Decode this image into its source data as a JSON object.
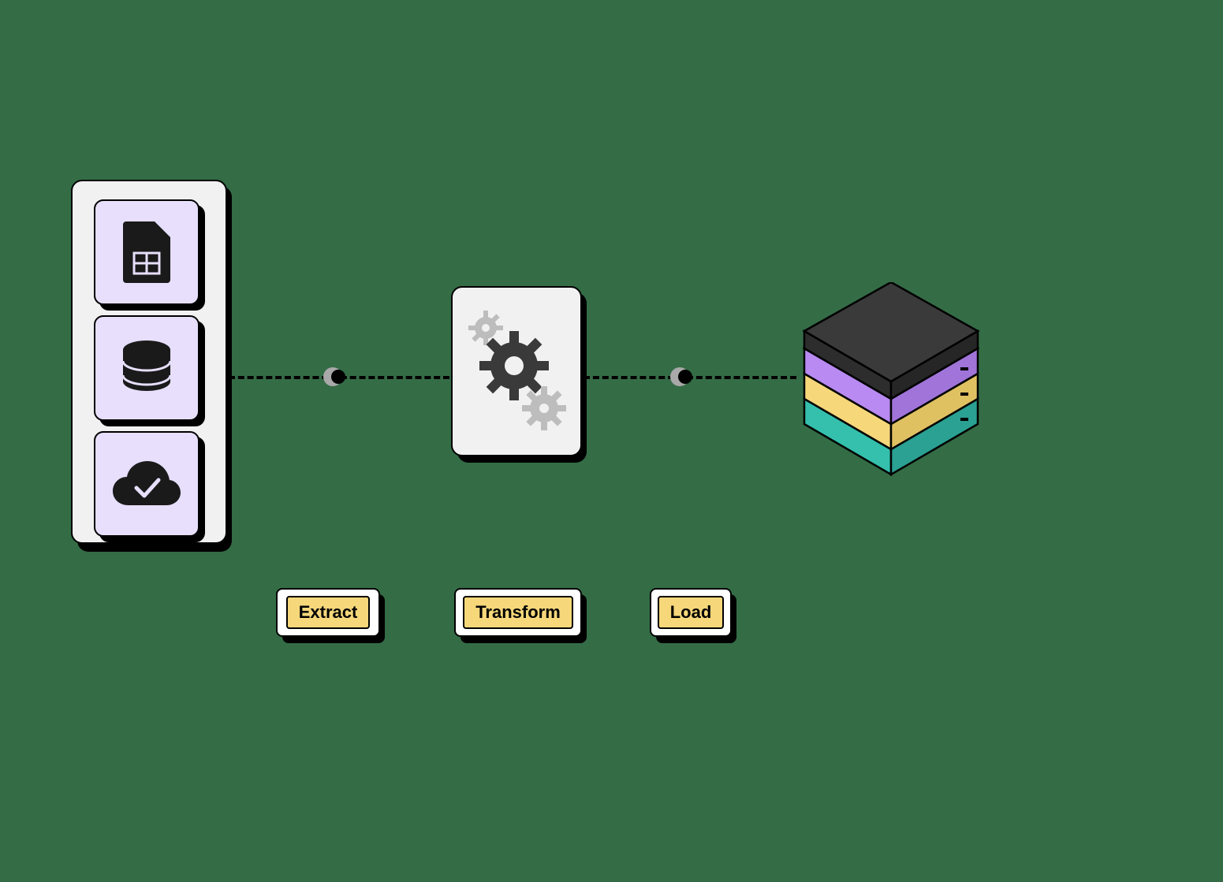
{
  "labels": {
    "extract": "Extract",
    "transform": "Transform",
    "load": "Load"
  },
  "icons": {
    "source1": "spreadsheet-file-icon",
    "source2": "database-icon",
    "source3": "cloud-check-icon",
    "transform": "gears-icon",
    "target": "server-stack-icon"
  },
  "colors": {
    "tile_bg": "#e7dffc",
    "panel_bg": "#f1f1f1",
    "label_bg": "#f6d77a",
    "server_purple": "#b98af2",
    "server_yellow": "#f6d77a",
    "server_teal": "#34c0ad",
    "server_top": "#3a3a3a"
  }
}
